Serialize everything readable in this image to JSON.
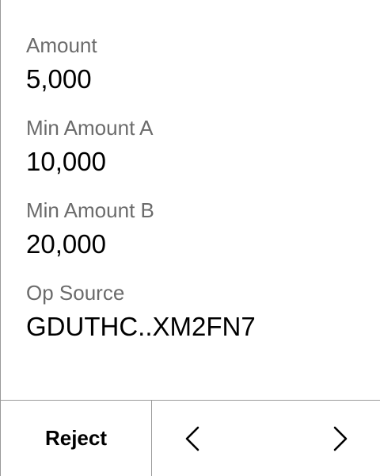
{
  "fields": [
    {
      "label": "Amount",
      "value": "5,000"
    },
    {
      "label": "Min Amount A",
      "value": "10,000"
    },
    {
      "label": "Min Amount B",
      "value": "20,000"
    },
    {
      "label": "Op Source",
      "value": "GDUTHC..XM2FN7"
    }
  ],
  "footer": {
    "reject_label": "Reject",
    "prev_icon": "chevron-left-icon",
    "next_icon": "chevron-right-icon"
  },
  "colors": {
    "label": "#6b6b6b",
    "value": "#000000",
    "divider": "#9a9a9a",
    "background": "#ffffff"
  }
}
